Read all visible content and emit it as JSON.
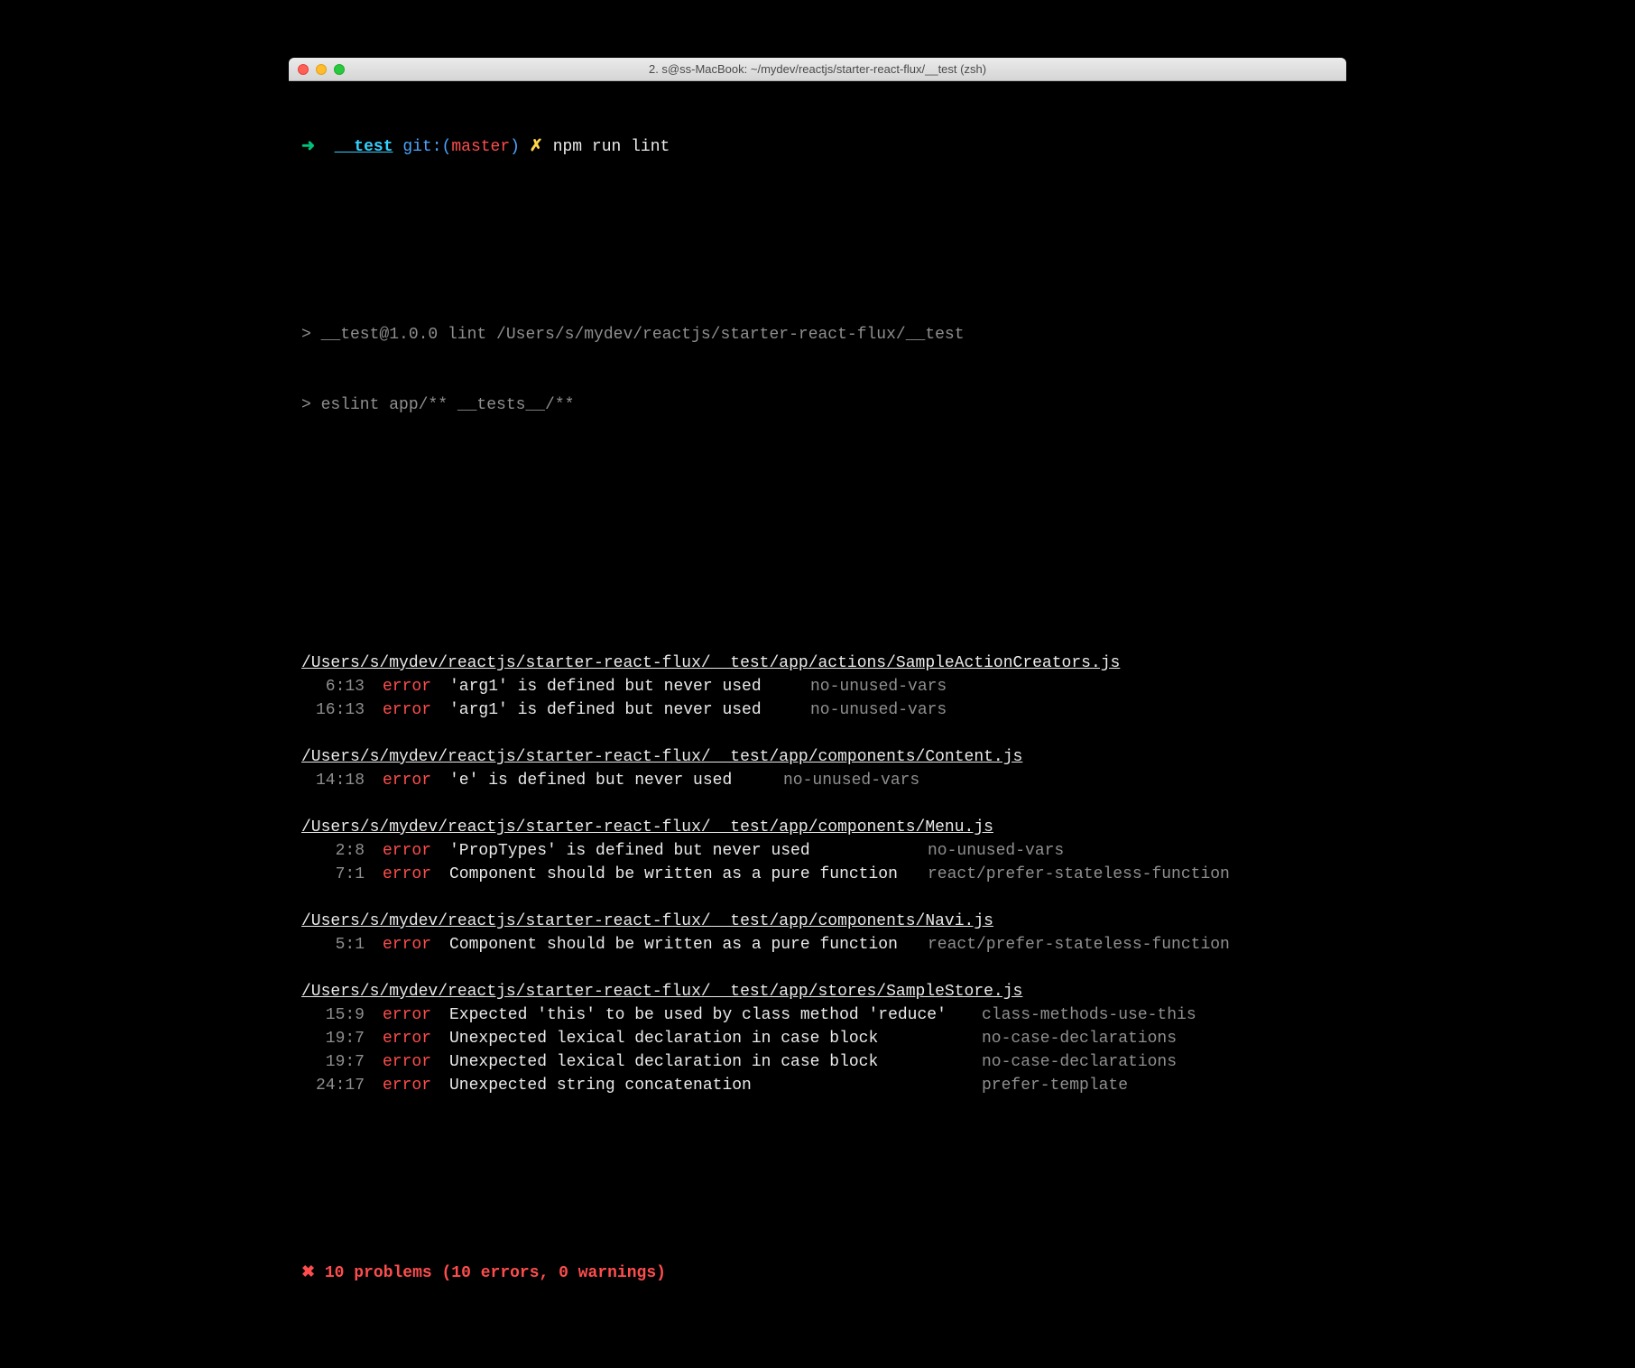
{
  "window": {
    "title": "2. s@ss-MacBook: ~/mydev/reactjs/starter-react-flux/__test (zsh)"
  },
  "prompt": {
    "arrow": "➜",
    "dir": "__test",
    "git_label": "git:(",
    "branch": "master",
    "git_close": ")",
    "dirty": "✗",
    "command": "npm run lint"
  },
  "npm": {
    "line1": "> __test@1.0.0 lint /Users/s/mydev/reactjs/starter-react-flux/__test",
    "line2": "> eslint app/** __tests__/**"
  },
  "blocks": [
    {
      "file": "/Users/s/mydev/reactjs/starter-react-flux/__test/app/actions/SampleActionCreators.js",
      "msg_w": 380,
      "pad3_w": 20,
      "issues": [
        {
          "loc": "6:13",
          "sev": "error",
          "msg": "'arg1' is defined but never used",
          "rule": "no-unused-vars"
        },
        {
          "loc": "16:13",
          "sev": "error",
          "msg": "'arg1' is defined but never used",
          "rule": "no-unused-vars"
        }
      ]
    },
    {
      "file": "/Users/s/mydev/reactjs/starter-react-flux/__test/app/components/Content.js",
      "msg_w": 350,
      "pad3_w": 20,
      "issues": [
        {
          "loc": "14:18",
          "sev": "error",
          "msg": "'e' is defined but never used",
          "rule": "no-unused-vars"
        }
      ]
    },
    {
      "file": "/Users/s/mydev/reactjs/starter-react-flux/__test/app/components/Menu.js",
      "msg_w": 510,
      "pad3_w": 20,
      "issues": [
        {
          "loc": "2:8",
          "sev": "error",
          "msg": "'PropTypes' is defined but never used",
          "rule": "no-unused-vars"
        },
        {
          "loc": "7:1",
          "sev": "error",
          "msg": "Component should be written as a pure function",
          "rule": "react/prefer-stateless-function"
        }
      ]
    },
    {
      "file": "/Users/s/mydev/reactjs/starter-react-flux/__test/app/components/Navi.js",
      "msg_w": 510,
      "pad3_w": 20,
      "issues": [
        {
          "loc": "5:1",
          "sev": "error",
          "msg": "Component should be written as a pure function",
          "rule": "react/prefer-stateless-function"
        }
      ]
    },
    {
      "file": "/Users/s/mydev/reactjs/starter-react-flux/__test/app/stores/SampleStore.js",
      "msg_w": 570,
      "pad3_w": 20,
      "issues": [
        {
          "loc": "15:9",
          "sev": "error",
          "msg": "Expected 'this' to be used by class method 'reduce'",
          "rule": "class-methods-use-this"
        },
        {
          "loc": "19:7",
          "sev": "error",
          "msg": "Unexpected lexical declaration in case block",
          "rule": "no-case-declarations"
        },
        {
          "loc": "19:7",
          "sev": "error",
          "msg": "Unexpected lexical declaration in case block",
          "rule": "no-case-declarations"
        },
        {
          "loc": "24:17",
          "sev": "error",
          "msg": "Unexpected string concatenation",
          "rule": "prefer-template"
        }
      ]
    }
  ],
  "summary": "✖ 10 problems (10 errors, 0 warnings)"
}
